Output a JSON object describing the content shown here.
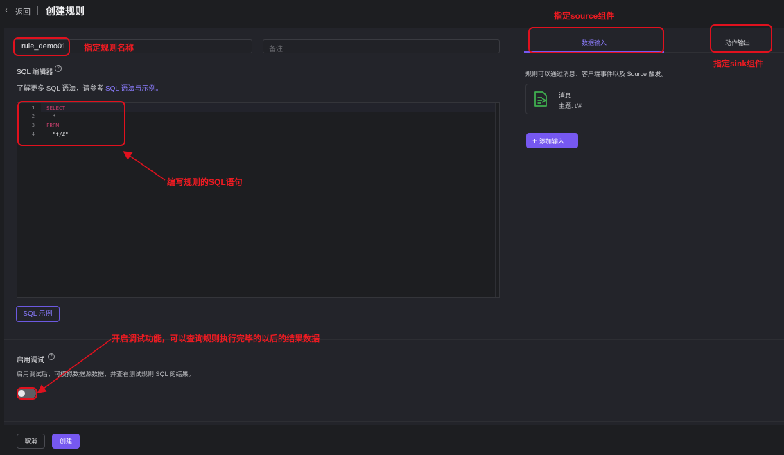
{
  "header": {
    "back_label": "返回",
    "title": "创建规则"
  },
  "form": {
    "rule_name_value": "rule_demo01",
    "notes_placeholder": "备注",
    "sql_label": "SQL 编辑器",
    "sql_hint_prefix": "了解更多 SQL 语法，请参考 ",
    "sql_hint_link": "SQL 语法与示例。",
    "sql_example_button": "SQL 示例"
  },
  "editor": {
    "lines": [
      {
        "number": "1",
        "text": "SELECT"
      },
      {
        "number": "2",
        "text": "  *"
      },
      {
        "number": "3",
        "text": "FROM"
      },
      {
        "number": "4",
        "text": "  \"t/#\""
      }
    ]
  },
  "debug": {
    "label": "启用调试",
    "description": "启用调试后，可模拟数据源数据，并查看测试规则 SQL 的结果。",
    "enabled": false
  },
  "footer": {
    "cancel_label": "取消",
    "create_label": "创建"
  },
  "right_panel": {
    "tabs": [
      {
        "label": "数据输入",
        "active": true
      },
      {
        "label": "动作输出",
        "active": false
      }
    ],
    "source_hint": "规则可以通过消息、客户端事件以及 Source 触发。",
    "source_card": {
      "title": "消息",
      "topic": "主题: t/#",
      "icon": "message-doc-icon"
    },
    "add_input_button": "添加输入"
  },
  "annotations": {
    "source_component": "指定source组件",
    "rule_name": "指定规则名称",
    "sink_component": "指定sink组件",
    "sql_statement": "编写规则的SQL语句",
    "debug_feature": "开启调试功能，可以查询规则执行完毕的以后的结果数据"
  },
  "colors": {
    "accent": "#7658f0",
    "annotation": "#e0111e",
    "background": "#1d1e21"
  }
}
